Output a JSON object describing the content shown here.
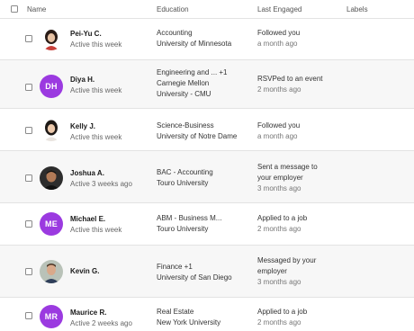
{
  "header": {
    "name": "Name",
    "education": "Education",
    "last_engaged": "Last Engaged",
    "labels": "Labels"
  },
  "rows": [
    {
      "name": "Pei-Yu C.",
      "status": "Active this week",
      "avatar": "portrait-photo",
      "education": [
        "Accounting",
        "University of Minnesota"
      ],
      "engaged": [
        "Followed you"
      ],
      "engaged_time": "a month ago"
    },
    {
      "name": "Diya H.",
      "status": "Active this week",
      "initials": "DH",
      "education": [
        "Engineering and ...  +1",
        "Carnegie Mellon",
        "University - CMU"
      ],
      "engaged": [
        "RSVPed to an event"
      ],
      "engaged_time": "2 months ago"
    },
    {
      "name": "Kelly J.",
      "status": "Active this week",
      "avatar": "portrait-photo",
      "education": [
        "Science-Business",
        "University of Notre Dame"
      ],
      "engaged": [
        "Followed you"
      ],
      "engaged_time": "a month ago"
    },
    {
      "name": "Joshua A.",
      "status": "Active 3 weeks ago",
      "avatar": "portrait-photo",
      "education": [
        "BAC - Accounting",
        "Touro University"
      ],
      "engaged": [
        "Sent a message to",
        "your employer"
      ],
      "engaged_time": "3 months ago"
    },
    {
      "name": "Michael E.",
      "status": "Active this week",
      "initials": "ME",
      "education": [
        "ABM - Business M...",
        "Touro University"
      ],
      "engaged": [
        "Applied to a job"
      ],
      "engaged_time": "2 months ago"
    },
    {
      "name": "Kevin G.",
      "status": "",
      "avatar": "portrait-photo",
      "education": [
        "Finance  +1",
        "University of San Diego"
      ],
      "engaged": [
        "Messaged by your",
        "employer"
      ],
      "engaged_time": "3 months ago"
    },
    {
      "name": "Maurice R.",
      "status": "Active 2 weeks ago",
      "initials": "MR",
      "education": [
        "Real Estate",
        "New York University"
      ],
      "engaged": [
        "Applied to a job"
      ],
      "engaged_time": "2 months ago"
    }
  ],
  "colors": {
    "initials_bg": "#9b3ae0",
    "alt_row_bg": "#f7f7f7"
  }
}
